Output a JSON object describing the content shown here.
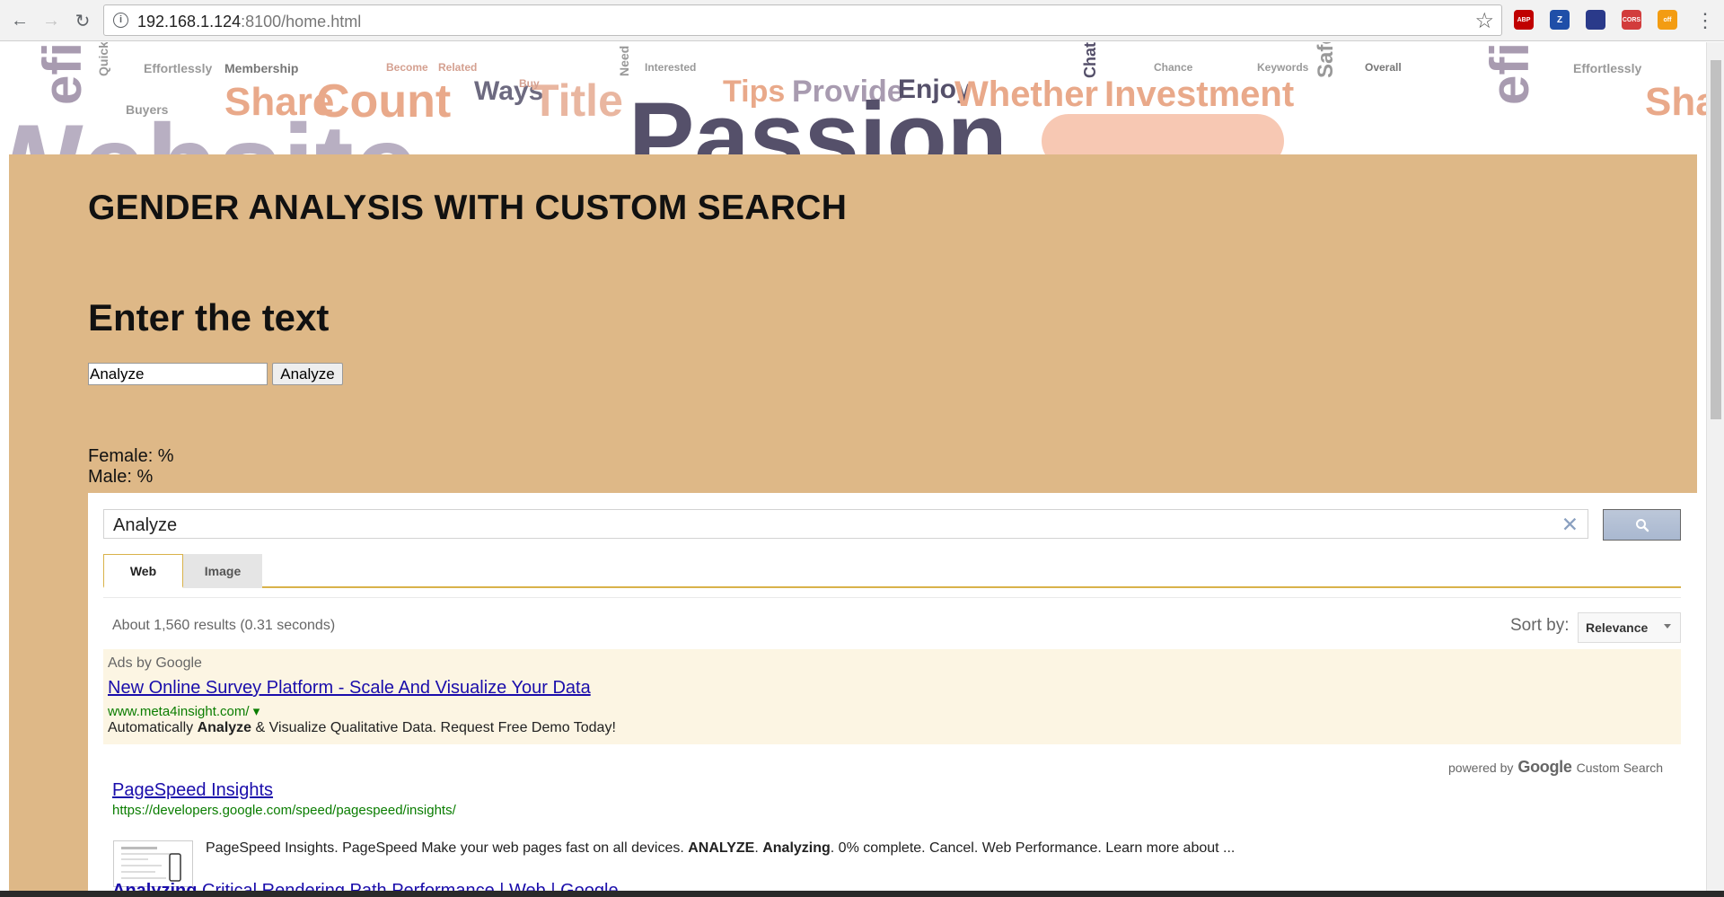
{
  "browser": {
    "url_host": "192.168.1.124",
    "url_rest": ":8100/home.html",
    "extensions": [
      {
        "name": "abp-icon",
        "label": "ABP",
        "color": "#c00000"
      },
      {
        "name": "zotero-icon",
        "label": "Z",
        "color": "#1f4fa8"
      },
      {
        "name": "extension-icon",
        "label": "",
        "color": "#2a3a8a"
      },
      {
        "name": "cors-icon",
        "label": "CORS",
        "color": "#d23c3c"
      },
      {
        "name": "off-toggle-icon",
        "label": "off",
        "color": "#f39c12"
      }
    ]
  },
  "banner": {
    "words": [
      "efits",
      "Share",
      "Count",
      "Ways",
      "Title",
      "Tips",
      "Provide",
      "Enjoy",
      "Whether",
      "Investment",
      "Passion",
      "Membership",
      "Effortlessly",
      "Quickly",
      "Chat",
      "Safely",
      "Overall",
      "Keywords",
      "Chance",
      "Interested",
      "Need",
      "Become",
      "Related",
      "Buy",
      "Buyers",
      "Website",
      "efits",
      "Effortlessly",
      "Sha"
    ]
  },
  "page": {
    "title": "GENDER ANALYSIS WITH CUSTOM SEARCH",
    "subtitle": "Enter the text",
    "input_value": "Analyze",
    "analyze_button": "Analyze",
    "female": "Female: %",
    "male": "Male: %"
  },
  "search": {
    "query": "Analyze",
    "tabs": [
      {
        "label": "Web"
      },
      {
        "label": "Image"
      }
    ],
    "results_info": "About 1,560 results (0.31 seconds)",
    "sort_label": "Sort by:",
    "sort_value": "Relevance",
    "ads_by": "Ads by Google",
    "ad": {
      "title": "New Online Survey Platform - Scale And Visualize Your Data",
      "url": "www.meta4insight.com/ ▾",
      "desc_pre": "Automatically ",
      "desc_bold": "Analyze",
      "desc_post": " & Visualize Qualitative Data. Request Free Demo Today!"
    },
    "powered_by": "powered by",
    "google": "Google",
    "custom_search": "Custom Search",
    "results": [
      {
        "title": "PageSpeed Insights",
        "url": "https://developers.google.com/speed/pagespeed/insights/",
        "snippet_pre": "PageSpeed Insights. PageSpeed Make your web pages fast on all devices. ",
        "snippet_b1": "ANALYZE",
        "snippet_mid": ". ",
        "snippet_b2": "Analyzing",
        "snippet_post": ". 0% complete. Cancel. Web Performance. Learn more about ..."
      },
      {
        "title_bold": "Analyzing",
        "title_rest": " Critical Rendering Path Performance | Web | Google ..."
      }
    ]
  }
}
